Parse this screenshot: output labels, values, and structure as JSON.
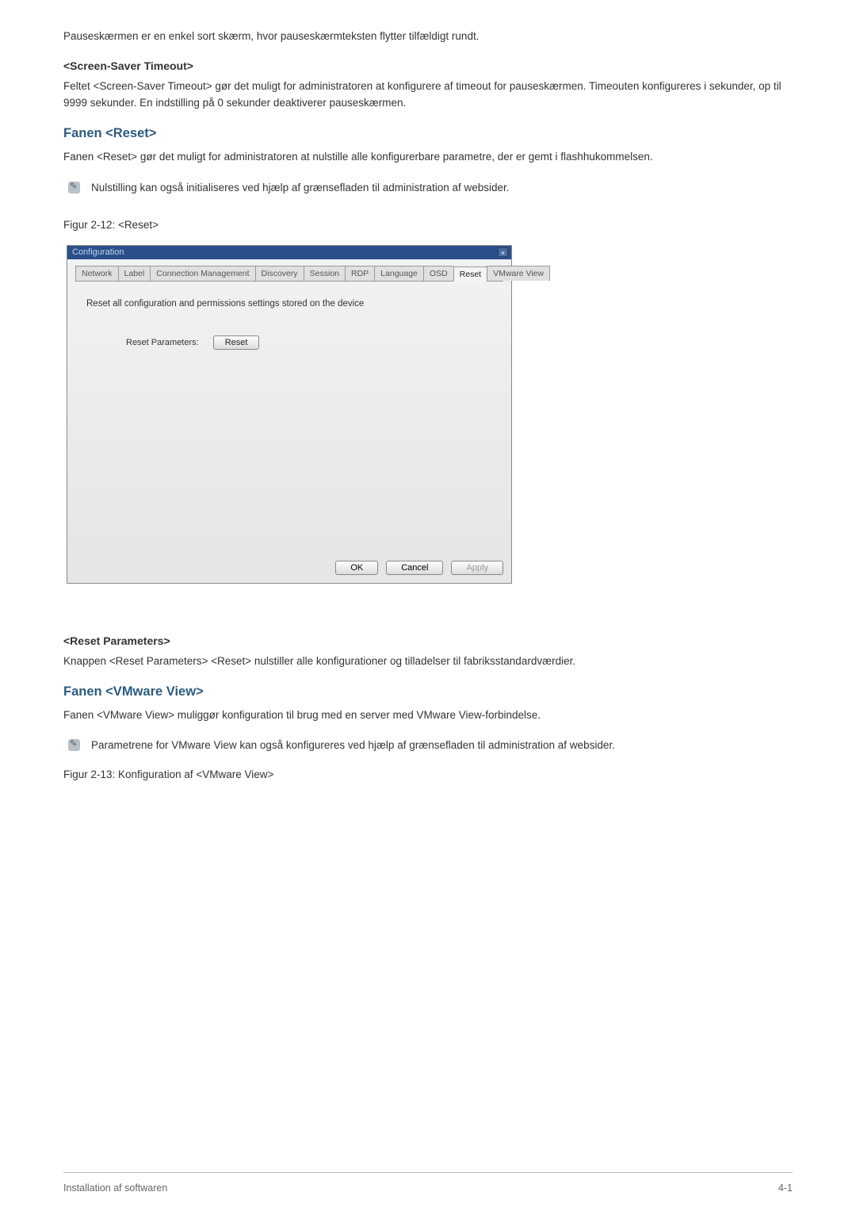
{
  "body": {
    "p1": "Pauseskærmen er en enkel sort skærm, hvor pauseskærmteksten flytter tilfældigt rundt.",
    "h1": "<Screen-Saver Timeout>",
    "p2": "Feltet <Screen-Saver Timeout> gør det muligt for administratoren at konfigurere af timeout for pauseskærmen. Timeouten konfigureres i sekunder, op til 9999 sekunder. En indstilling på 0 sekunder deaktiverer pauseskærmen.",
    "h2": "Fanen <Reset>",
    "p3": "Fanen <Reset> gør det muligt for administratoren at nulstille alle konfigurerbare parametre, der er gemt i flashhukommelsen.",
    "note1": "Nulstilling kan også initialiseres ved hjælp af grænsefladen til administration af websider.",
    "fig1": "Figur 2-12: <Reset>",
    "h3": "<Reset Parameters>",
    "p4": "Knappen <Reset Parameters> <Reset> nulstiller alle konfigurationer og tilladelser til fabriksstandardværdier.",
    "h4": "Fanen <VMware View>",
    "p5": "Fanen <VMware View> muliggør konfiguration til brug med en server med VMware View-forbindelse.",
    "note2": "Parametrene for VMware View kan også konfigureres ved hjælp af grænsefladen til administration af websider.",
    "fig2": "Figur 2-13: Konfiguration af <VMware View>"
  },
  "dialog": {
    "title": "Configuration",
    "tabs": {
      "network": "Network",
      "label": "Label",
      "connmgmt": "Connection Management",
      "discovery": "Discovery",
      "session": "Session",
      "rdp": "RDP",
      "language": "Language",
      "osd": "OSD",
      "reset": "Reset",
      "vmware": "VMware View"
    },
    "instruction": "Reset all configuration and permissions settings stored on the device",
    "reset_label": "Reset Parameters:",
    "reset_button": "Reset",
    "ok": "OK",
    "cancel": "Cancel",
    "apply": "Apply"
  },
  "footer": {
    "left": "Installation af softwaren",
    "right": "4-1"
  }
}
